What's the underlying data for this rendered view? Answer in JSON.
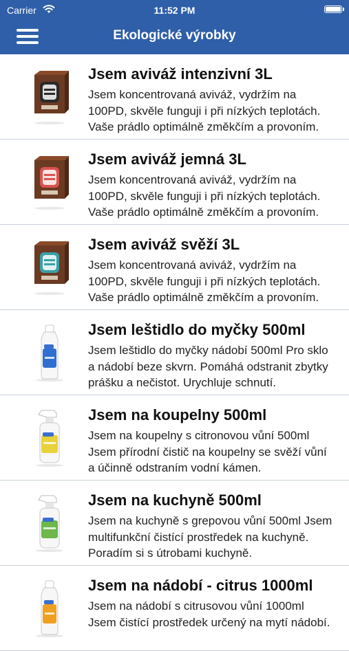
{
  "status_bar": {
    "carrier": "Carrier",
    "time": "11:52 PM",
    "icons": [
      "wifi-icon",
      "battery-icon"
    ]
  },
  "nav": {
    "title": "Ekologické výrobky",
    "menu_icon": "hamburger-menu-icon",
    "bar_color": "#2f5fa8"
  },
  "products": [
    {
      "title": "Jsem aviváž intenzivní 3L",
      "description": "Jsem koncentrovaná aviváž, vydržím na 100PD, skvěle funguji i při nízkých teplotách. Vaše prádlo optimálně změkčím a provoním.",
      "image": "fabric-softener-box",
      "label_color": "#2a2a2a"
    },
    {
      "title": "Jsem aviváž jemná 3L",
      "description": "Jsem koncentrovaná aviváž, vydržím na 100PD, skvěle funguji i při nízkých teplotách. Vaše prádlo optimálně změkčím a provoním.",
      "image": "fabric-softener-box",
      "label_color": "#d9534f"
    },
    {
      "title": "Jsem aviváž svěží 3L",
      "description": "Jsem koncentrovaná aviváž, vydržím na 100PD, skvěle funguji i při nízkých teplotách. Vaše prádlo optimálně změkčím a provoním.",
      "image": "fabric-softener-box",
      "label_color": "#3aa0a8"
    },
    {
      "title": "Jsem leštidlo do myčky 500ml",
      "description": "Jsem leštidlo do myčky nádobí 500ml Pro sklo a nádobí beze skvrn. Pomáhá odstranit zbytky prášku a nečistot. Urychluje schnutí.",
      "image": "bottle",
      "label_color": "#2f6fd0"
    },
    {
      "title": "Jsem na koupelny 500ml",
      "description": "Jsem na koupelny s citronovou vůní 500ml Jsem přírodní čistič na koupelny se svěží vůní a účinně odstraním vodní kámen.",
      "image": "spray-bottle",
      "label_color": "#e8d23a"
    },
    {
      "title": "Jsem na kuchyně 500ml",
      "description": "Jsem na kuchyně s grepovou vůní 500ml Jsem multifunkční čistící prostředek na kuchyně. Poradím si s útrobami kuchyně.",
      "image": "spray-bottle",
      "label_color": "#6cb84a"
    },
    {
      "title": "Jsem na nádobí - citrus 1000ml",
      "description": "Jsem na nádobí s citrusovou vůní 1000ml Jsem čistící prostředek určený na mytí nádobí.",
      "image": "bottle",
      "label_color": "#f0a020"
    }
  ]
}
